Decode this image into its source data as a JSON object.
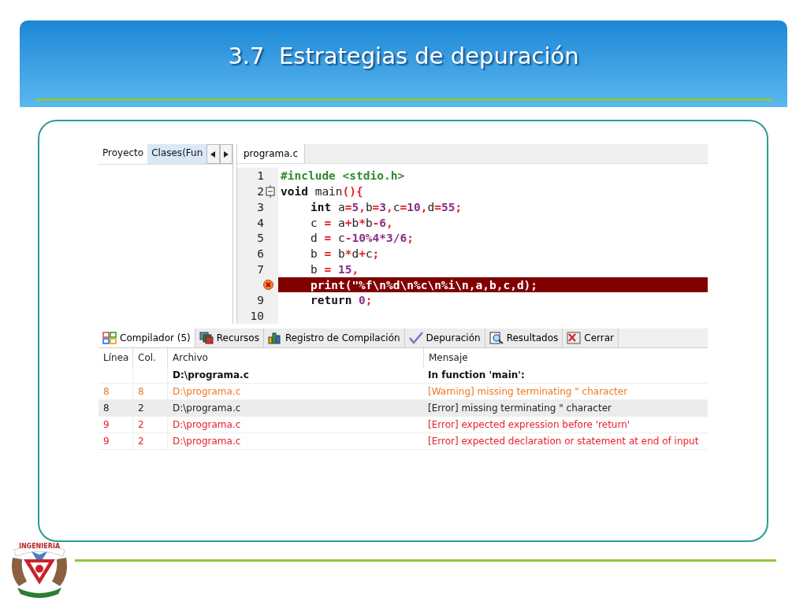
{
  "slide": {
    "title": "3.7  Estrategias de depuración",
    "logo_text": "INGENIERIA"
  },
  "ide": {
    "left_tabs": [
      {
        "label": "Proyecto",
        "selected": true
      },
      {
        "label": "Clases(Fun",
        "selected": false
      }
    ],
    "editor_tabs": [
      {
        "label": "programa.c",
        "selected": true
      }
    ],
    "code_lines": [
      {
        "number": "1",
        "indented": false,
        "tokens": [
          {
            "kind": "pre",
            "t": "#include <stdio.h>"
          }
        ]
      },
      {
        "number": "2",
        "fold": true,
        "indented": false,
        "tokens": [
          {
            "kind": "kw",
            "t": "void"
          },
          {
            "kind": "plain",
            "t": " main"
          },
          {
            "kind": "op",
            "t": "(){"
          }
        ]
      },
      {
        "number": "3",
        "indented": true,
        "tokens": [
          {
            "kind": "kw",
            "t": "int"
          },
          {
            "kind": "plain",
            "t": " a"
          },
          {
            "kind": "op",
            "t": "="
          },
          {
            "kind": "num",
            "t": "5"
          },
          {
            "kind": "op",
            "t": ","
          },
          {
            "kind": "plain",
            "t": "b"
          },
          {
            "kind": "op",
            "t": "="
          },
          {
            "kind": "num",
            "t": "3"
          },
          {
            "kind": "op",
            "t": ","
          },
          {
            "kind": "plain",
            "t": "c"
          },
          {
            "kind": "op",
            "t": "="
          },
          {
            "kind": "num",
            "t": "10"
          },
          {
            "kind": "op",
            "t": ","
          },
          {
            "kind": "plain",
            "t": "d"
          },
          {
            "kind": "op",
            "t": "="
          },
          {
            "kind": "num",
            "t": "55"
          },
          {
            "kind": "op",
            "t": ";"
          }
        ]
      },
      {
        "number": "4",
        "indented": true,
        "tokens": [
          {
            "kind": "plain",
            "t": "c "
          },
          {
            "kind": "op",
            "t": "="
          },
          {
            "kind": "plain",
            "t": " a"
          },
          {
            "kind": "op",
            "t": "+"
          },
          {
            "kind": "plain",
            "t": "b"
          },
          {
            "kind": "op",
            "t": "*"
          },
          {
            "kind": "plain",
            "t": "b"
          },
          {
            "kind": "op",
            "t": "-"
          },
          {
            "kind": "num",
            "t": "6"
          },
          {
            "kind": "op",
            "t": ","
          }
        ]
      },
      {
        "number": "5",
        "indented": true,
        "tokens": [
          {
            "kind": "plain",
            "t": "d "
          },
          {
            "kind": "op",
            "t": "="
          },
          {
            "kind": "plain",
            "t": " c"
          },
          {
            "kind": "op",
            "t": "-"
          },
          {
            "kind": "num",
            "t": "10%4*3/6"
          },
          {
            "kind": "op",
            "t": ";"
          }
        ]
      },
      {
        "number": "6",
        "indented": true,
        "tokens": [
          {
            "kind": "plain",
            "t": "b "
          },
          {
            "kind": "op",
            "t": "="
          },
          {
            "kind": "plain",
            "t": " b"
          },
          {
            "kind": "op",
            "t": "*"
          },
          {
            "kind": "plain",
            "t": "d"
          },
          {
            "kind": "op",
            "t": "+"
          },
          {
            "kind": "plain",
            "t": "c"
          },
          {
            "kind": "op",
            "t": ";"
          }
        ]
      },
      {
        "number": "7",
        "indented": true,
        "tokens": [
          {
            "kind": "plain",
            "t": "b "
          },
          {
            "kind": "op",
            "t": "="
          },
          {
            "kind": "num",
            "t": " 15"
          },
          {
            "kind": "op",
            "t": ","
          }
        ]
      },
      {
        "error_mark": true,
        "highlighted": true,
        "indented": true,
        "tokens": [
          {
            "kind": "plain",
            "t": "print(\"%f\\n%d\\n%c\\n%i\\n,a,b,c,d);"
          }
        ]
      },
      {
        "number": "9",
        "indented": true,
        "tokens": [
          {
            "kind": "kw",
            "t": "return"
          },
          {
            "kind": "num",
            "t": " 0"
          },
          {
            "kind": "op",
            "t": ";"
          }
        ]
      },
      {
        "number": "10"
      }
    ],
    "bottom_tabs": [
      {
        "label": "Compilador (5)",
        "selected": true
      },
      {
        "label": "Recursos",
        "selected": false
      },
      {
        "label": "Registro de Compilación",
        "selected": false
      },
      {
        "label": "Depuración",
        "selected": false
      },
      {
        "label": "Resultados",
        "selected": false
      },
      {
        "label": "Cerrar",
        "selected": false
      }
    ],
    "table": {
      "columns": [
        "Línea",
        "Col.",
        "Archivo",
        "Mensaje"
      ],
      "rows": [
        {
          "kind": "group",
          "selected": false,
          "cells": [
            "",
            "",
            "D:\\programa.c",
            "In function 'main':"
          ]
        },
        {
          "kind": "warning",
          "selected": false,
          "cells": [
            "8",
            "8",
            "D:\\programa.c",
            "[Warning] missing terminating \" character"
          ]
        },
        {
          "kind": "error",
          "selected": true,
          "cells": [
            "8",
            "2",
            "D:\\programa.c",
            "[Error] missing terminating \" character"
          ]
        },
        {
          "kind": "error",
          "selected": false,
          "cells": [
            "9",
            "2",
            "D:\\programa.c",
            "[Error] expected expression before 'return'"
          ]
        },
        {
          "kind": "error",
          "selected": false,
          "cells": [
            "9",
            "2",
            "D:\\programa.c",
            "[Error] expected declaration or statement at end of input"
          ]
        }
      ]
    }
  }
}
